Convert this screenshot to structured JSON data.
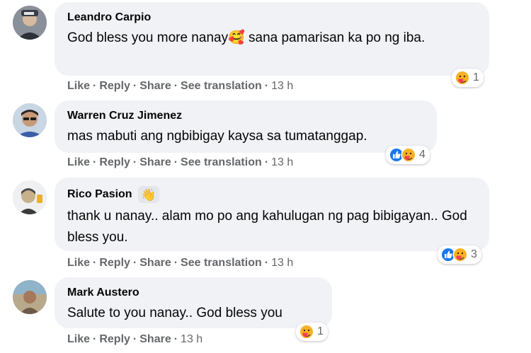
{
  "comments": [
    {
      "name": "Leandro Carpio",
      "text": "God bless you more nanay🥰 sana pamarisan ka po ng iba.",
      "reaction_count": "1",
      "reaction_icons": [
        "care-emoji-icon"
      ],
      "actions": {
        "like": "Like",
        "reply": "Reply",
        "share": "Share",
        "translate": "See translation",
        "time": "13 h"
      }
    },
    {
      "name": "Warren Cruz Jimenez",
      "text": "mas mabuti ang ngbibigay kaysa sa tumatanggap.",
      "reaction_count": "4",
      "reaction_icons": [
        "like-icon",
        "care-emoji-icon"
      ],
      "actions": {
        "like": "Like",
        "reply": "Reply",
        "share": "Share",
        "translate": "See translation",
        "time": "13 h"
      }
    },
    {
      "name": "Rico Pasion",
      "badge": "👋",
      "text": "thank u nanay.. alam mo po ang kahulugan ng pag bibigayan.. God bless you.",
      "reaction_count": "3",
      "reaction_icons": [
        "like-icon",
        "care-emoji-icon"
      ],
      "actions": {
        "like": "Like",
        "reply": "Reply",
        "share": "Share",
        "translate": "See translation",
        "time": "13 h"
      }
    },
    {
      "name": "Mark Austero",
      "text": "Salute to you nanay.. God bless you",
      "reaction_count": "1",
      "reaction_icons": [
        "care-emoji-icon"
      ],
      "actions": {
        "like": "Like",
        "reply": "Reply",
        "share": "Share",
        "time": "13 h"
      }
    }
  ],
  "separator": "·",
  "colors": {
    "bubble": "#f0f2f5",
    "secondary_text": "#65676b",
    "like_blue": "#1877f2",
    "care_yellow": "#f7b125"
  }
}
